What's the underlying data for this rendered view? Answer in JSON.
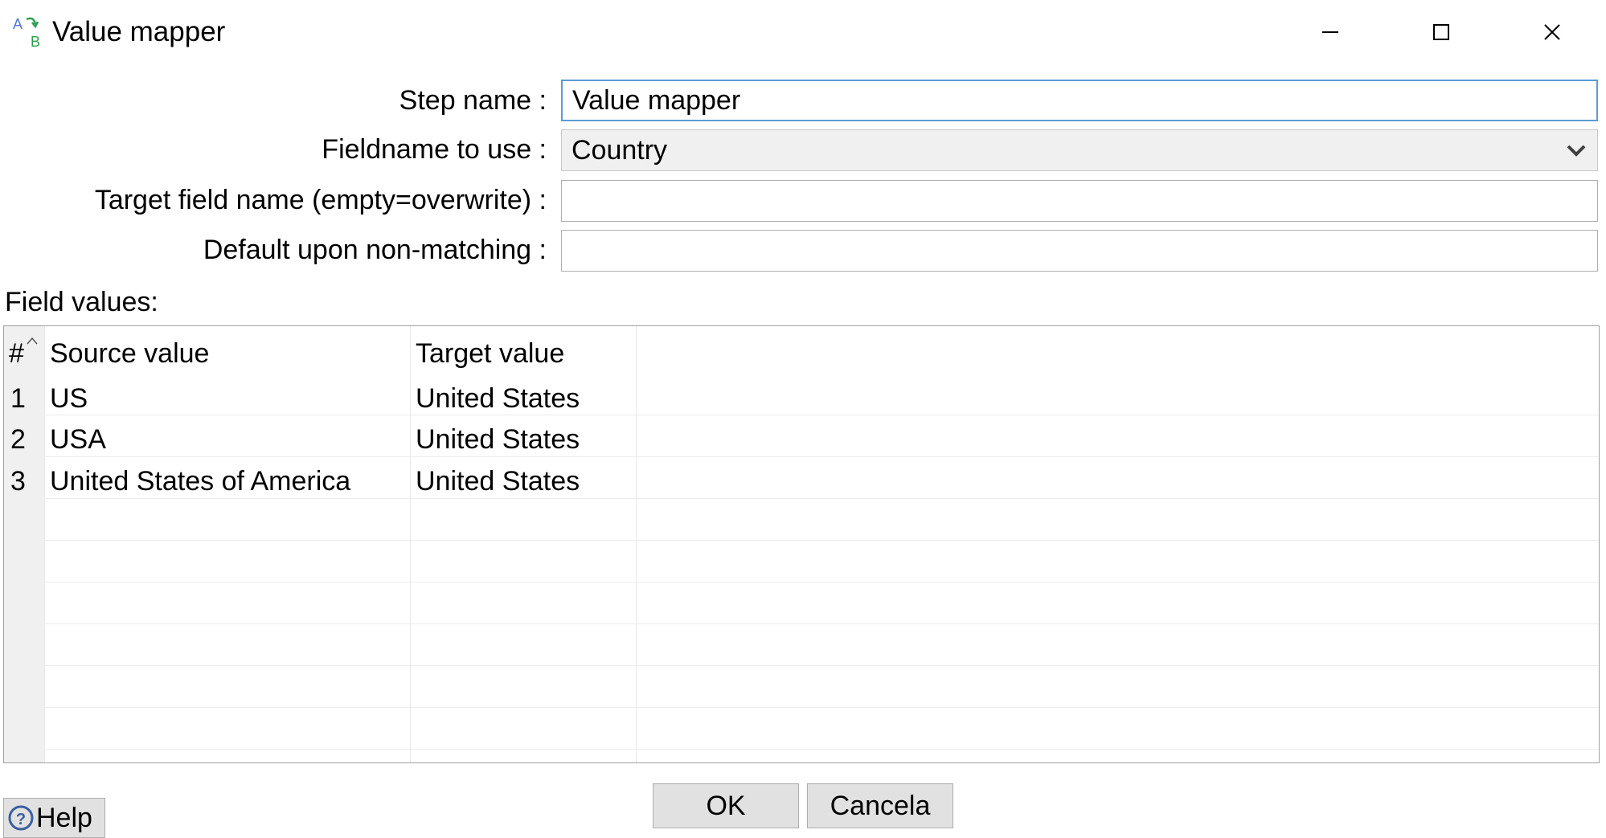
{
  "window": {
    "title": "Value mapper",
    "app_icon": "value-mapper-icon",
    "controls": [
      "minimize-icon",
      "maximize-icon",
      "close-icon"
    ]
  },
  "form": {
    "step_name_label": "Step name :",
    "step_name_value": "Value mapper",
    "fieldname_label": "Fieldname to use :",
    "fieldname_value": "Country",
    "target_field_label": "Target field name (empty=overwrite) :",
    "target_field_value": "",
    "default_label": "Default upon non-matching :",
    "default_value": ""
  },
  "field_values": {
    "label": "Field values:",
    "columns": [
      "#",
      "Source value",
      "Target value"
    ],
    "rows": [
      {
        "num": "1",
        "source": "US",
        "target": "United States"
      },
      {
        "num": "2",
        "source": "USA",
        "target": "United States"
      },
      {
        "num": "3",
        "source": "United States of America",
        "target": "United States"
      }
    ]
  },
  "buttons": {
    "ok": "OK",
    "cancel": "Cancela",
    "help": "Help"
  },
  "colors": {
    "focus_border": "#5b9bd5",
    "button_bg": "#e1e1e1",
    "icon_green": "#2e9e4f",
    "icon_blue": "#4a7bd0"
  }
}
